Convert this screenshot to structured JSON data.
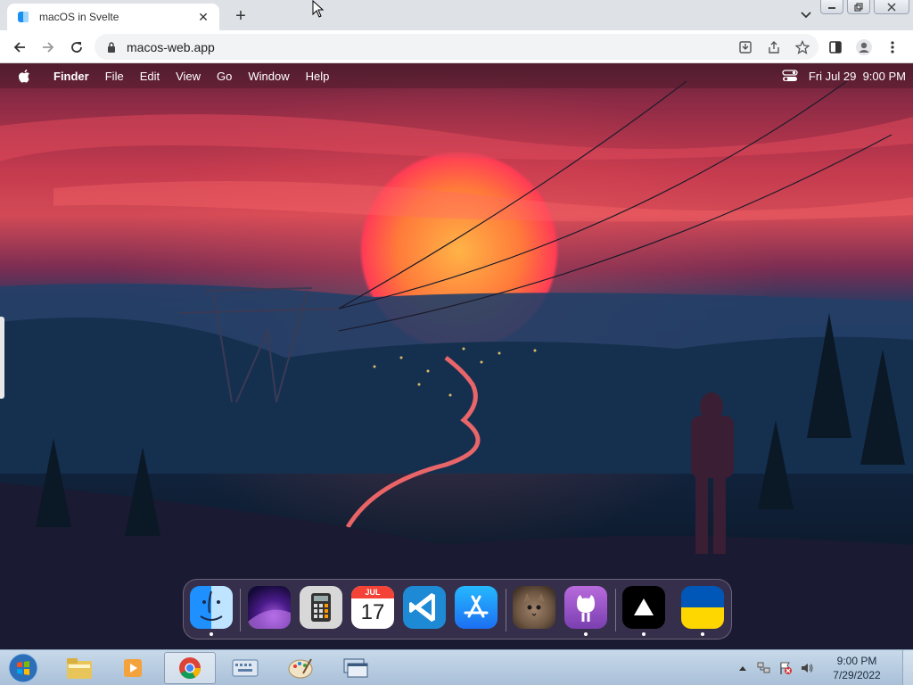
{
  "browser": {
    "tab_title": "macOS in Svelte",
    "new_tab_symbol": "+",
    "close_symbol": "✕",
    "url": "macos-web.app"
  },
  "menubar": {
    "app_name": "Finder",
    "items": [
      "File",
      "Edit",
      "View",
      "Go",
      "Window",
      "Help"
    ],
    "datetime": "Fri Jul 29  9:00 PM"
  },
  "dock": {
    "apps": [
      {
        "name": "Finder",
        "icon": "finder-icon",
        "running": true
      },
      {
        "name": "Wallpapers",
        "icon": "wallpaper-icon",
        "running": false
      },
      {
        "name": "Calculator",
        "icon": "calculator-icon",
        "running": false
      },
      {
        "name": "Calendar",
        "icon": "calendar-icon",
        "running": false,
        "month": "JUL",
        "day": "17"
      },
      {
        "name": "VS Code",
        "icon": "vscode-icon",
        "running": false
      },
      {
        "name": "App Store",
        "icon": "app-store-icon",
        "running": false
      },
      {
        "name": "Purus Twitter",
        "icon": "cat-icon",
        "running": false
      },
      {
        "name": "GitHub",
        "icon": "github-icon",
        "running": true
      },
      {
        "name": "Vercel",
        "icon": "vercel-icon",
        "running": true
      },
      {
        "name": "Ukraine",
        "icon": "ukraine-flag-icon",
        "running": true
      }
    ]
  },
  "taskbar": {
    "time": "9:00 PM",
    "date": "7/29/2022"
  },
  "colors": {
    "ukraine_blue": "#0057b7",
    "ukraine_yellow": "#ffd700",
    "vscode_blue": "#1e8ad6",
    "app_store_blue": "#1c8cf2"
  }
}
